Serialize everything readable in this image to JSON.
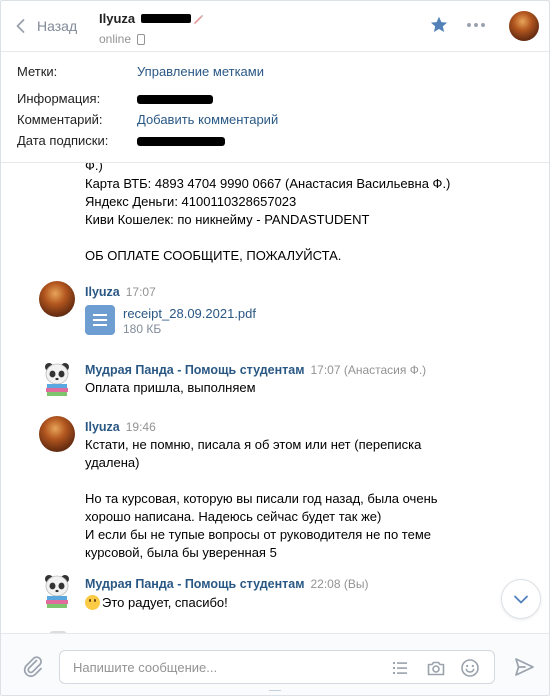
{
  "header": {
    "back_label": "Назад",
    "peer_name": "Ilyuza",
    "peer_status": "online"
  },
  "info": {
    "labels_label": "Метки:",
    "labels_value": "Управление метками",
    "information_label": "Информация:",
    "comment_label": "Комментарий:",
    "comment_value": "Добавить комментарий",
    "subscription_label": "Дата подписки:"
  },
  "chat": {
    "partial_message": {
      "lines": [
        "Ф.)",
        "Карта ВТБ: 4893 4704 9990 0667 (Анастасия Васильевна Ф.)",
        "Яндекс Деньги: 4100110328657023",
        "Киви Кошелек: по никнейму - PANDASTUDENT",
        "",
        "ОБ ОПЛАТЕ СООБЩИТЕ, ПОЖАЛУЙСТА."
      ]
    },
    "messages": [
      {
        "author": "Ilyuza",
        "time": "17:07",
        "attachment": {
          "name": "receipt_28.09.2021.pdf",
          "size": "180 КБ"
        }
      },
      {
        "author": "Мудрая Панда - Помощь студентам",
        "time": "17:07 (Анастасия Ф.)",
        "lines": [
          "Оплата пришла, выполняем"
        ]
      },
      {
        "author": "Ilyuza",
        "time": "19:46",
        "lines": [
          "Кстати, не помню, писала я об этом или нет (переписка",
          "удалена)",
          "",
          "Но та курсовая, которую вы писали год назад, была очень",
          "хорошо написана. Надеюсь сейчас будет так же)",
          "И если бы не тупые вопросы от руководителя не по теме",
          "курсовой, была бы уверенная 5"
        ]
      },
      {
        "author": "Мудрая Панда - Помощь студентам",
        "time": "22:08 (Вы)",
        "text": "Это радует, спасибо!",
        "emoji": "smiling-face"
      }
    ]
  },
  "composer": {
    "placeholder": "Напишите сообщение..."
  },
  "colors": {
    "link": "#2a5885",
    "muted": "#939393",
    "accent": "#5181b8"
  }
}
